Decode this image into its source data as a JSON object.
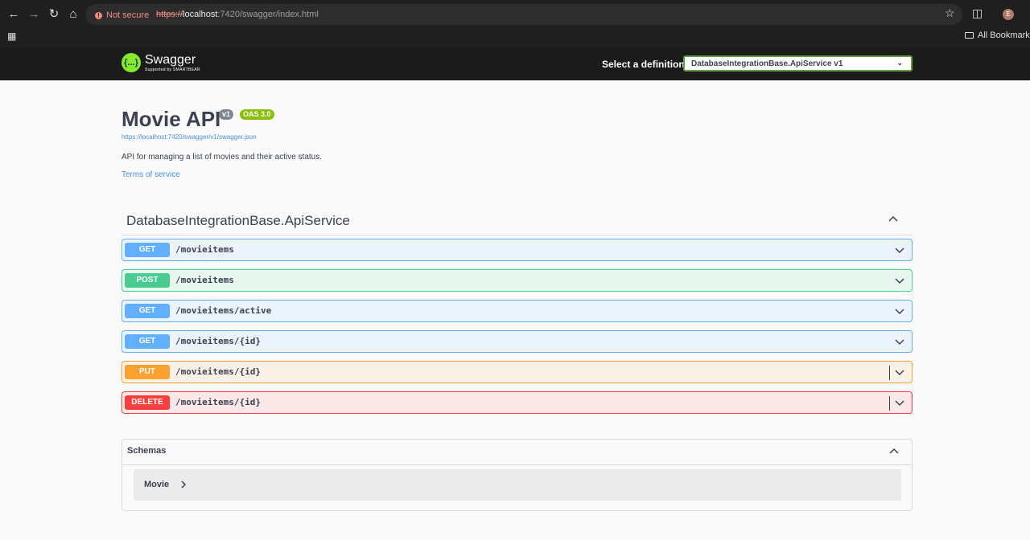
{
  "browser": {
    "security_label": "Not secure",
    "url_proto": "https://",
    "url_host": "localhost",
    "url_rest": ":7420/swagger/index.html",
    "bookmarks_label": "All Bookmarks",
    "profile_initial": "E"
  },
  "topbar": {
    "logo_text": "Swagger",
    "logo_sub": "Supported by SMARTBEAR",
    "logo_glyph": "{...}",
    "definition_label": "Select a definition",
    "definition_value": "DatabaseIntegrationBase.ApiService v1"
  },
  "info": {
    "title": "Movie API",
    "version_badge": "v1",
    "oas_badge": "OAS 3.0",
    "spec_url": "https://localhost:7420/swagger/v1/swagger.json",
    "description": "API for managing a list of movies and their active status.",
    "terms_label": "Terms of service"
  },
  "tag": {
    "name": "DatabaseIntegrationBase.ApiService"
  },
  "operations": [
    {
      "method": "GET",
      "path": "/movieitems"
    },
    {
      "method": "POST",
      "path": "/movieitems"
    },
    {
      "method": "GET",
      "path": "/movieitems/active"
    },
    {
      "method": "GET",
      "path": "/movieitems/{id}"
    },
    {
      "method": "PUT",
      "path": "/movieitems/{id}"
    },
    {
      "method": "DELETE",
      "path": "/movieitems/{id}"
    }
  ],
  "schemas": {
    "title": "Schemas",
    "models": [
      {
        "name": "Movie"
      }
    ]
  },
  "colors": {
    "get": "#61affe",
    "post": "#49cc90",
    "put": "#fca130",
    "delete": "#f93e3e",
    "swagger_green": "#85ea2d"
  }
}
